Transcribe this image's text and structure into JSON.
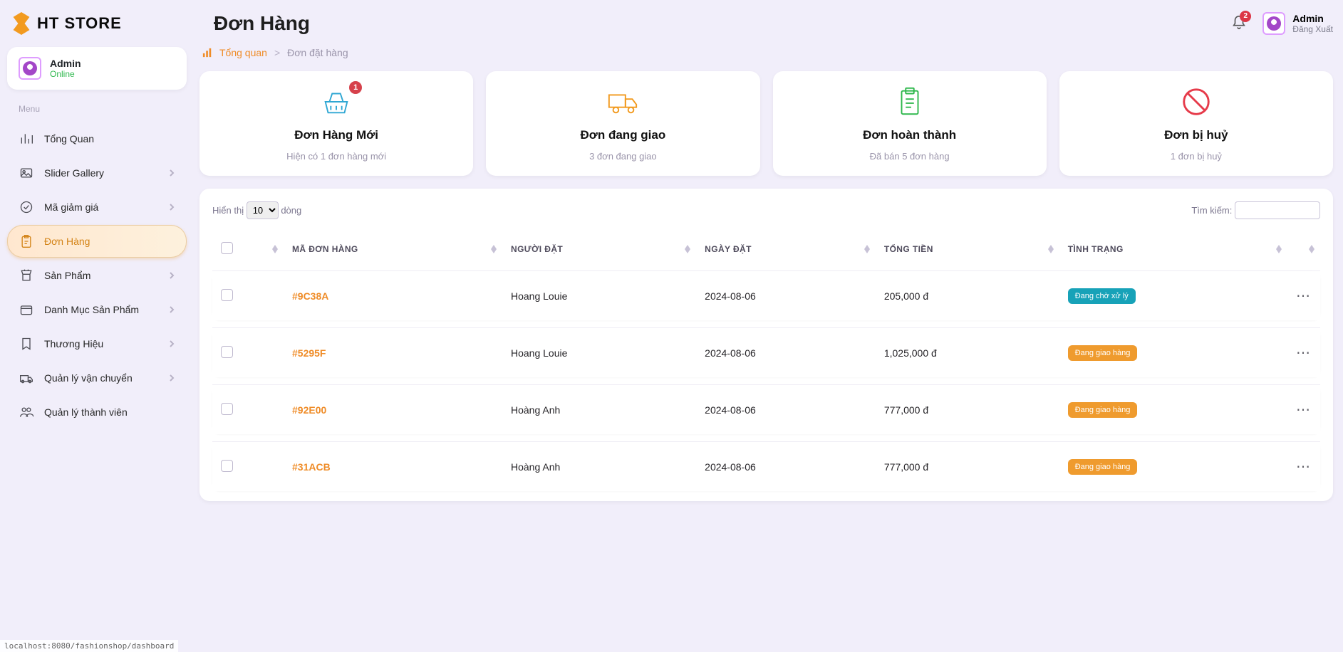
{
  "brand": "HT STORE",
  "page_title": "Đơn Hàng",
  "bell_count": "2",
  "user": {
    "name": "Admin",
    "status": "Online",
    "logout": "Đăng Xuất"
  },
  "side_section": "Menu",
  "nav": [
    {
      "label": "Tổng Quan",
      "has_chev": false
    },
    {
      "label": "Slider Gallery",
      "has_chev": true
    },
    {
      "label": "Mã giảm giá",
      "has_chev": true
    },
    {
      "label": "Đơn Hàng",
      "has_chev": false,
      "active": true
    },
    {
      "label": "Sản Phẩm",
      "has_chev": true
    },
    {
      "label": "Danh Mục Sản Phẩm",
      "has_chev": true
    },
    {
      "label": "Thương Hiệu",
      "has_chev": true
    },
    {
      "label": "Quản lý vận chuyển",
      "has_chev": true
    },
    {
      "label": "Quản lý thành viên",
      "has_chev": false
    }
  ],
  "crumb_home": "Tổng quan",
  "crumb_here": "Đơn đặt hàng",
  "cards": {
    "new": {
      "title": "Đơn Hàng Mới",
      "sub": "Hiện có 1 đơn hàng mới",
      "badge": "1"
    },
    "ship": {
      "title": "Đơn đang giao",
      "sub": "3 đơn đang giao"
    },
    "done": {
      "title": "Đơn hoàn thành",
      "sub": "Đã bán 5 đơn hàng"
    },
    "cancel": {
      "title": "Đơn bị huỷ",
      "sub": "1 đơn bị huỷ"
    }
  },
  "table": {
    "show_prefix": "Hiển thị",
    "show_suffix": "dòng",
    "page_size": "10",
    "search_label": "Tìm kiếm:",
    "cols": {
      "id": "Mã đơn hàng",
      "user": "Người đặt",
      "date": "Ngày đặt",
      "total": "Tổng tiền",
      "status": "Tình trạng"
    },
    "status_labels": {
      "wait": "Đang chờ xử lý",
      "ship": "Đang giao hàng"
    },
    "rows": [
      {
        "id": "#9C38A",
        "user": "Hoang Louie",
        "date": "2024-08-06",
        "total": "205,000 đ",
        "status": "wait"
      },
      {
        "id": "#5295F",
        "user": "Hoang Louie",
        "date": "2024-08-06",
        "total": "1,025,000 đ",
        "status": "ship"
      },
      {
        "id": "#92E00",
        "user": "Hoàng Anh",
        "date": "2024-08-06",
        "total": "777,000 đ",
        "status": "ship"
      },
      {
        "id": "#31ACB",
        "user": "Hoàng Anh",
        "date": "2024-08-06",
        "total": "777,000 đ",
        "status": "ship"
      }
    ]
  },
  "status_bar": "localhost:8080/fashionshop/dashboard"
}
